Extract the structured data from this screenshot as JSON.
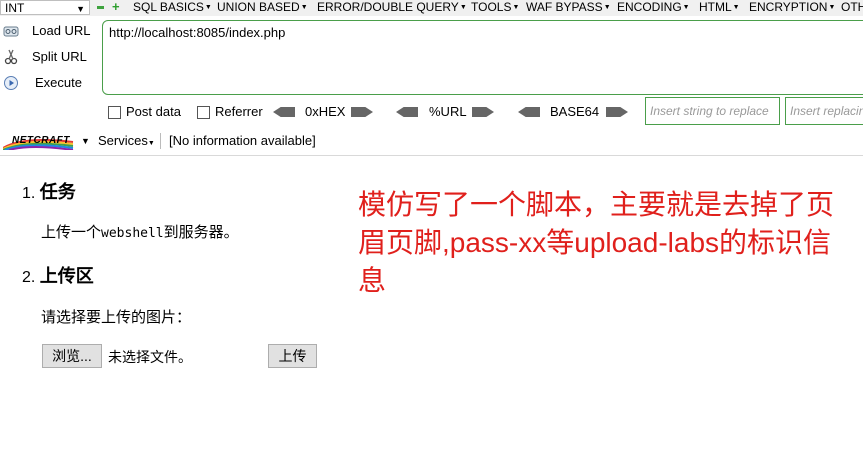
{
  "toolbar": {
    "select_value": "INT",
    "menus": [
      "SQL BASICS",
      "UNION BASED",
      "ERROR/DOUBLE QUERY",
      "TOOLS",
      "WAF BYPASS",
      "ENCODING",
      "HTML",
      "ENCRYPTION",
      "OTH"
    ]
  },
  "left_panel": {
    "load_url": "Load URL",
    "split_url": "Split URL",
    "execute": "Execute"
  },
  "url_value": "http://localhost:8085/index.php",
  "options": {
    "post_data": "Post data",
    "referrer": "Referrer",
    "hex": "0xHEX",
    "url": "%URL",
    "base64": "BASE64",
    "insert_placeholder_1": "Insert string to replace",
    "insert_placeholder_2": "Insert replacing string"
  },
  "netcraft": {
    "logo": "NETCRAFT",
    "services": "Services",
    "info": "[No information available]"
  },
  "page": {
    "section1_num": "1.",
    "section1_title": "任务",
    "section1_text_a": "上传一个",
    "section1_text_code": "webshell",
    "section1_text_b": "到服务器。",
    "section2_num": "2.",
    "section2_title": "上传区",
    "section2_text": "请选择要上传的图片：",
    "browse_button": "浏览...",
    "no_file": "未选择文件。",
    "upload_button": "上传"
  },
  "annotation": "模仿写了一个脚本，主要就是去掉了页眉页脚,pass-xx等upload-labs的标识信息",
  "colors": {
    "annotation": "#e0201c",
    "green_border": "#4a9e4a"
  }
}
